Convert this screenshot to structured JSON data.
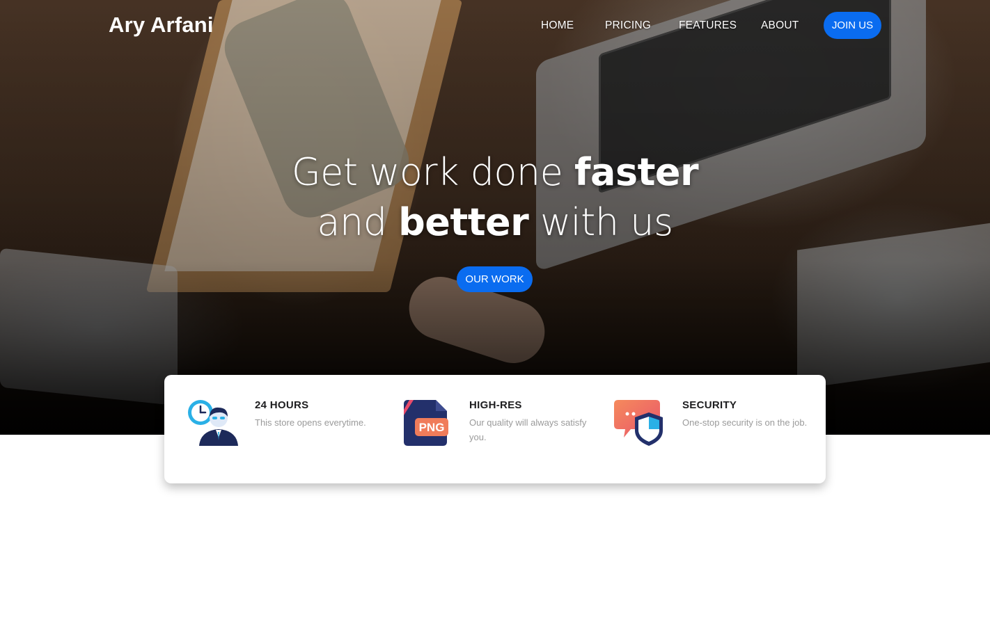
{
  "brand": {
    "name": "Ary Arfani"
  },
  "nav": {
    "links": [
      "HOME",
      "PRICING",
      "FEATURES",
      "ABOUT"
    ],
    "join_label": "JOIN US"
  },
  "hero": {
    "line1_light": "Get work done ",
    "line1_bold": "faster",
    "line2_light_a": "and ",
    "line2_bold": "better",
    "line2_light_b": " with us",
    "cta_label": "OUR WORK"
  },
  "features": [
    {
      "icon": "clock-person-icon",
      "title": "24 HOURS",
      "desc": "This store opens everytime."
    },
    {
      "icon": "png-file-icon",
      "title": "HIGH-RES",
      "desc": "Our quality will always satisfy you."
    },
    {
      "icon": "shield-chat-icon",
      "title": "SECURITY",
      "desc": "One-stop security is on the job."
    }
  ],
  "colors": {
    "accent": "#0a6cf0",
    "title_text": "#1d1d1f",
    "muted_text": "#9a9a9a"
  },
  "icon_text": {
    "png_badge": "PNG"
  }
}
